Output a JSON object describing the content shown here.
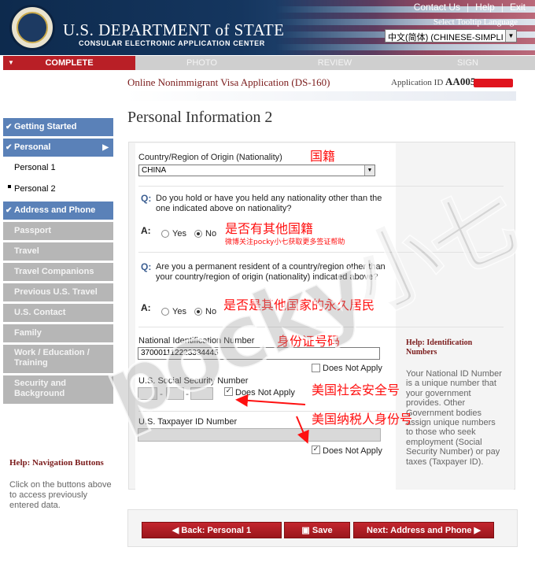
{
  "header": {
    "dept_title": "U.S. DEPARTMENT of STATE",
    "dept_subtitle": "CONSULAR ELECTRONIC APPLICATION CENTER",
    "links": [
      "Contact Us",
      "Help",
      "Exit"
    ],
    "tooltip_label": "Select Tooltip Language",
    "language_value": "中文(简体) (CHINESE-SIMPLI"
  },
  "progress": {
    "steps": [
      {
        "label": "COMPLETE",
        "state": "done"
      },
      {
        "label": "PHOTO",
        "state": "todo"
      },
      {
        "label": "REVIEW",
        "state": "todo"
      },
      {
        "label": "SIGN",
        "state": "todo"
      }
    ],
    "active_color": "#b91f26"
  },
  "application": {
    "title": "Online Nonimmigrant Visa Application (DS-160)",
    "id_label": "Application ID",
    "id_value": "AA005"
  },
  "sidebar": {
    "items": [
      {
        "label": "Getting Started",
        "style": "blue",
        "check": true
      },
      {
        "label": "Personal",
        "style": "blue",
        "check": true,
        "caret": true
      },
      {
        "label": "Personal 1",
        "style": "sub"
      },
      {
        "label": "Personal 2",
        "style": "sub",
        "current": true
      },
      {
        "label": "Address and Phone",
        "style": "blue",
        "check": true
      },
      {
        "label": "Passport",
        "style": "grey"
      },
      {
        "label": "Travel",
        "style": "grey"
      },
      {
        "label": "Travel Companions",
        "style": "grey"
      },
      {
        "label": "Previous U.S. Travel",
        "style": "grey"
      },
      {
        "label": "U.S. Contact",
        "style": "grey"
      },
      {
        "label": "Family",
        "style": "grey"
      },
      {
        "label": "Work / Education / Training",
        "style": "grey",
        "two_line": true
      },
      {
        "label": "Security and Background",
        "style": "grey",
        "two_line": true
      }
    ],
    "help_title": "Help: Navigation Buttons",
    "help_text": "Click on the buttons above to access previously entered data."
  },
  "main": {
    "page_title": "Personal Information 2",
    "nationality_label": "Country/Region of Origin (Nationality)",
    "nationality_value": "CHINA",
    "q1_text": "Do you hold or have you held any nationality other than the one indicated above on nationality?",
    "q2_text": "Are you a permanent resident of a country/region other than your country/region of origin (nationality) indicated above?",
    "q_mark": "Q:",
    "a_mark": "A:",
    "yes_label": "Yes",
    "no_label": "No",
    "q1_answer": "No",
    "q2_answer": "No",
    "national_id_label": "National Identification Number",
    "national_id_value": "370001112223334445",
    "does_not_apply": "Does Not Apply",
    "ssn_label": "U.S. Social Security Number",
    "taxpayer_label": "U.S. Taxpayer ID Number",
    "national_id_dna_checked": false,
    "ssn_dna_checked": true,
    "taxpayer_dna_checked": true
  },
  "help_side": {
    "title": "Help: Identification Numbers",
    "text": "Your National ID Number is a unique number that your government provides. Other Government bodies assign unique numbers to those who seek employment (Social Security Number) or pay taxes (Taxpayer ID)."
  },
  "annotations": {
    "nationality": "国籍",
    "other_nationality": "是否有其他国籍",
    "weibo_note": "微博关注pocky小七获取更多签证帮助",
    "permanent_resident": "是否是其他国家的永久居民",
    "id_number": "身份证号码",
    "ssn": "美国社会安全号",
    "taxpayer": "美国纳税人身份号",
    "watermark": "pocky小七"
  },
  "buttons": {
    "back": "Back: Personal 1",
    "save": "Save",
    "next": "Next: Address and Phone"
  }
}
